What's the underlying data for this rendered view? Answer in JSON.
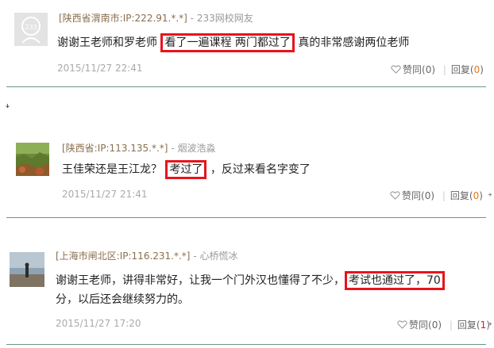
{
  "colors": {
    "highlight": "#e8141b",
    "location": "#8a6f4e",
    "divider": "#6f9684",
    "count": "#e07b1e"
  },
  "comments": [
    {
      "location": "[陕西省渭南市:IP:222.91.*.*]",
      "separator": "-",
      "user": "233网校网友",
      "text_before": "谢谢王老师和罗老师",
      "highlight": "看了一遍课程 两门都过了",
      "text_after": "真的非常感谢两位老师",
      "date": "2015/11/27 22:41",
      "like_label": "赞同",
      "like_count_open": "(",
      "like_count": "0",
      "like_count_close": ")",
      "reply_label": "回复",
      "reply_count_open": "(",
      "reply_count": "0",
      "reply_count_close": ")",
      "avatar_icon": "default-avatar-icon",
      "avatar_text": "233"
    },
    {
      "location": "[陕西省:IP:113.135.*.*]",
      "separator": "-",
      "user": "烟波浩淼",
      "text_before": "王佳荣还是王江龙？",
      "highlight": "考过了",
      "text_after": "，反过来看名字变了",
      "date": "2015/11/27 21:41",
      "like_label": "赞同",
      "like_count_open": "(",
      "like_count": "0",
      "like_count_close": ")",
      "reply_label": "回复",
      "reply_count_open": "(",
      "reply_count": "0",
      "reply_count_close": ")",
      "avatar_icon": "landscape-avatar-icon"
    },
    {
      "location": "[上海市闸北区:IP:116.231.*.*]",
      "separator": "-",
      "user": "心桥慌冰",
      "text_before": "谢谢王老师，讲得非常好，让我一个门外汉也懂得了不少，",
      "highlight": "考试也通过了，70",
      "text_after": "分，以后还会继续努力的。",
      "date": "2015/11/27 17:20",
      "like_label": "赞同",
      "like_count_open": "(",
      "like_count": "0",
      "like_count_close": ")",
      "reply_label": "回复",
      "reply_count_open": "(",
      "reply_count": "1",
      "reply_count_close": ")",
      "avatar_icon": "beach-person-avatar-icon"
    }
  ]
}
